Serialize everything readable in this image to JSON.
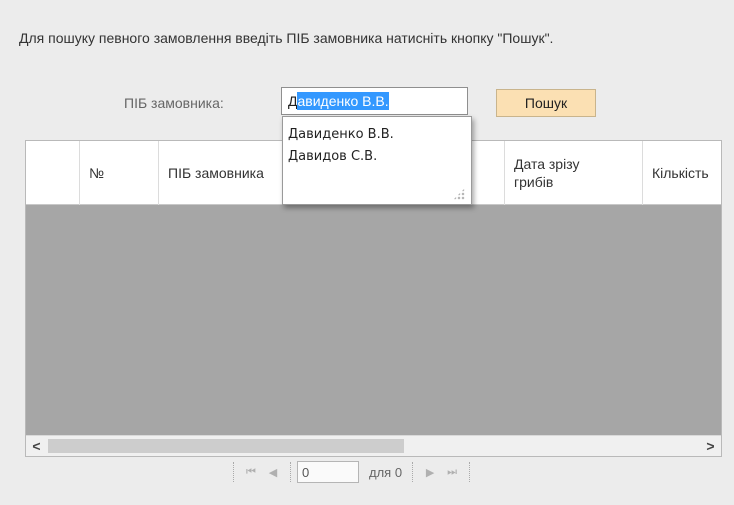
{
  "instructions": "Для пошуку певного замовлення введіть ПІБ замовника натисніть кнопку \"Пошук\".",
  "search": {
    "label": "ПІБ замовника:",
    "value_first_char": "Д",
    "value_selected": "авиденко В.В.",
    "button_label": "Пошук"
  },
  "autocomplete": {
    "items": [
      "Давиденко В.В.",
      "Давидов С.В."
    ]
  },
  "grid": {
    "columns": [
      "",
      "№",
      "ПІБ замовника",
      "",
      "Дата зрізу грибів",
      "Кількість"
    ]
  },
  "scrollbar": {
    "left_arrow": "<",
    "right_arrow": ">"
  },
  "pager": {
    "first": "⏮",
    "prev": "◀",
    "page_value": "0",
    "of_label": "для 0",
    "next": "▶",
    "last": "⏭"
  }
}
